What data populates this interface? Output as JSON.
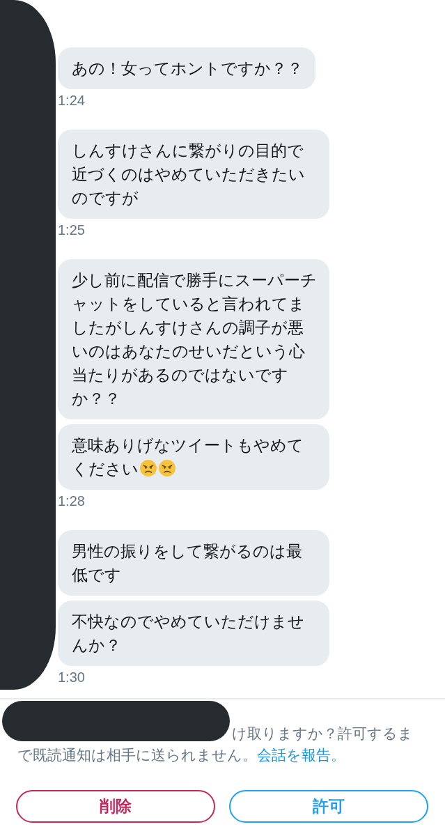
{
  "conversation": [
    {
      "messages": [
        {
          "text": "あの！女ってホントですか？？"
        }
      ],
      "time": "1:24"
    },
    {
      "messages": [
        {
          "text": "しんすけさんに繋がりの目的で近づくのはやめていただきたいのですが"
        }
      ],
      "time": "1:25"
    },
    {
      "messages": [
        {
          "text": "少し前に配信で勝手にスーパーチャットをしていると言われてましたがしんすけさんの調子が悪いのはあなたのせいだという心当たりがあるのではないですか？？"
        },
        {
          "text": "意味ありげなツイートもやめてください",
          "icons": [
            {
              "kind": "angry"
            },
            {
              "kind": "angry"
            }
          ]
        }
      ],
      "time": "1:28"
    },
    {
      "messages": [
        {
          "text": "男性の振りをして繋がるのは最低です"
        },
        {
          "text": "不快なのでやめていただけませんか？"
        }
      ],
      "time": "1:30"
    }
  ],
  "request_notice": {
    "text": "け取りますか？許可するまで既読通知は相手に送られません。",
    "link": "会話を報告。"
  },
  "buttons": [
    {
      "label": "削除",
      "kind": "delete"
    },
    {
      "label": "許可",
      "kind": "allow"
    }
  ]
}
